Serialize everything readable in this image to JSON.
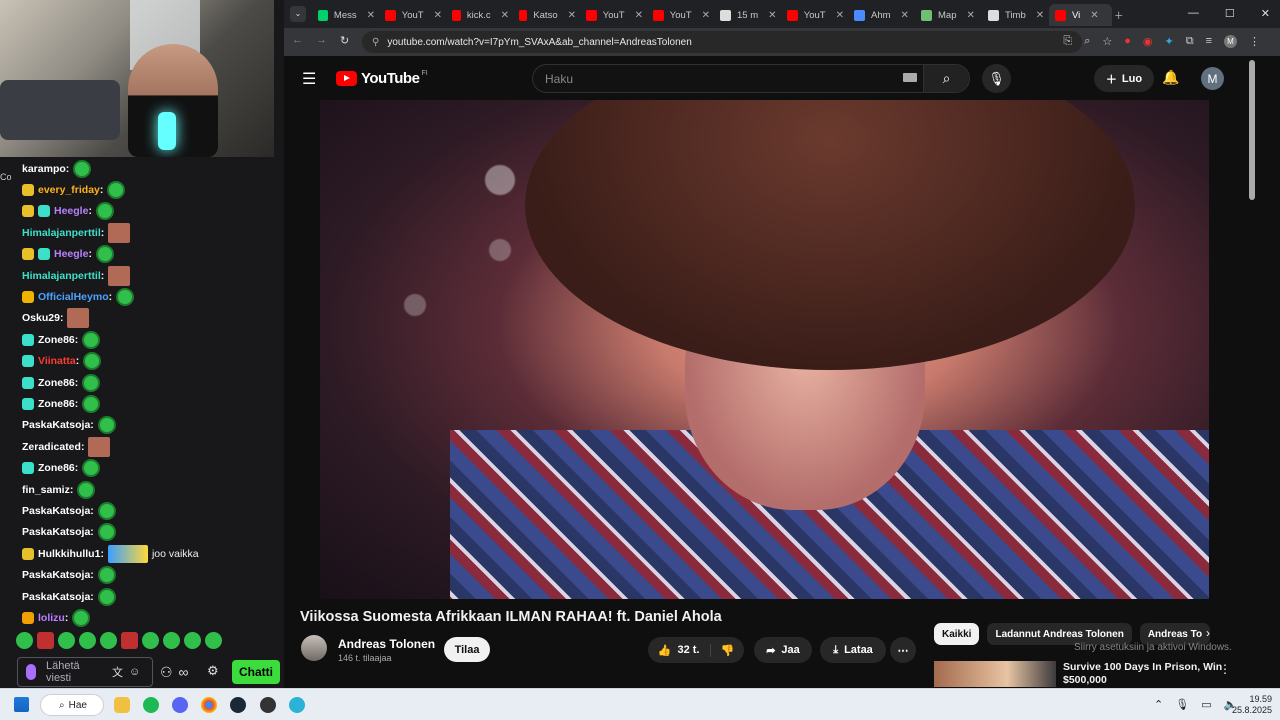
{
  "chat": {
    "messages": [
      {
        "user": "karampo",
        "color": "#ffffff",
        "badges": [],
        "emote": "green",
        "text": ""
      },
      {
        "user": "every_friday",
        "color": "#ffb31a",
        "badges": [
          "#e8c12a"
        ],
        "emote": "green",
        "text": ""
      },
      {
        "user": "Heegle",
        "color": "#b980ff",
        "badges": [
          "#e8c12a",
          "#3ce0c8"
        ],
        "emote": "green",
        "text": ""
      },
      {
        "user": "Himalajanperttil",
        "color": "#3ce0c8",
        "badges": [],
        "emote": "img",
        "text": ""
      },
      {
        "user": "Heegle",
        "color": "#b980ff",
        "badges": [
          "#e8c12a",
          "#3ce0c8"
        ],
        "emote": "green",
        "text": ""
      },
      {
        "user": "Himalajanperttil",
        "color": "#3ce0c8",
        "badges": [],
        "emote": "img",
        "text": ""
      },
      {
        "user": "OfficialHeymo",
        "color": "#4aa3ff",
        "badges": [
          "#f0b400"
        ],
        "emote": "green",
        "text": ""
      },
      {
        "user": "Osku29",
        "color": "#ffffff",
        "badges": [],
        "emote": "img",
        "text": ""
      },
      {
        "user": "Zone86",
        "color": "#ffffff",
        "badges": [
          "#3ce0c8"
        ],
        "emote": "green",
        "text": ""
      },
      {
        "user": "Viinatta",
        "color": "#ff3b30",
        "badges": [
          "#3ce0c8"
        ],
        "emote": "green",
        "text": ""
      },
      {
        "user": "Zone86",
        "color": "#ffffff",
        "badges": [
          "#3ce0c8"
        ],
        "emote": "green",
        "text": ""
      },
      {
        "user": "Zone86",
        "color": "#ffffff",
        "badges": [
          "#3ce0c8"
        ],
        "emote": "green",
        "text": ""
      },
      {
        "user": "PaskaKatsoja",
        "color": "#ffffff",
        "badges": [],
        "emote": "green",
        "text": ""
      },
      {
        "user": "Zeradicated",
        "color": "#ffffff",
        "badges": [],
        "emote": "img",
        "text": ""
      },
      {
        "user": "Zone86",
        "color": "#ffffff",
        "badges": [
          "#3ce0c8"
        ],
        "emote": "green",
        "text": ""
      },
      {
        "user": "fin_samiz",
        "color": "#ffffff",
        "badges": [],
        "emote": "green",
        "text": ""
      },
      {
        "user": "PaskaKatsoja",
        "color": "#ffffff",
        "badges": [],
        "emote": "green",
        "text": ""
      },
      {
        "user": "PaskaKatsoja",
        "color": "#ffffff",
        "badges": [],
        "emote": "green",
        "text": ""
      },
      {
        "user": "Hulkkihullu1",
        "color": "#ffffff",
        "badges": [
          "#e8c12a"
        ],
        "emote": "wide",
        "text": "joo vaikka"
      },
      {
        "user": "PaskaKatsoja",
        "color": "#ffffff",
        "badges": [],
        "emote": "green",
        "text": ""
      },
      {
        "user": "PaskaKatsoja",
        "color": "#ffffff",
        "badges": [],
        "emote": "green",
        "text": ""
      },
      {
        "user": "lolizu",
        "color": "#b980ff",
        "badges": [
          "#f0a000"
        ],
        "emote": "green",
        "text": ""
      }
    ],
    "side_label": "Co",
    "input_placeholder": "Lähetä viesti",
    "chat_button": "Chatti",
    "points_label": "∞"
  },
  "browser": {
    "tabs": [
      {
        "label": "Mess",
        "fav": "#00d16c"
      },
      {
        "label": "YouT",
        "fav": "#ff0000"
      },
      {
        "label": "kick.c",
        "fav": "#ff0000"
      },
      {
        "label": "Katso",
        "fav": "#ff0000"
      },
      {
        "label": "YouT",
        "fav": "#ff0000"
      },
      {
        "label": "YouT",
        "fav": "#ff0000"
      },
      {
        "label": "15 m",
        "fav": "#dddddd"
      },
      {
        "label": "YouT",
        "fav": "#ff0000"
      },
      {
        "label": "Ahm",
        "fav": "#4a8cff"
      },
      {
        "label": "Map",
        "fav": "#6fbf73"
      },
      {
        "label": "Timb",
        "fav": "#dddddd"
      },
      {
        "label": "Vi",
        "fav": "#ff0000"
      }
    ],
    "url": "youtube.com/watch?v=I7pYm_SVAxA&ab_channel=AndreasTolonen",
    "profile_initial": "M"
  },
  "youtube": {
    "logo_text": "YouTube",
    "region": "FI",
    "search_placeholder": "Haku",
    "create_label": "Luo",
    "avatar_initial": "M",
    "video_title": "Viikossa Suomesta Afrikkaan ILMAN RAHAA! ft. Daniel Ahola",
    "channel_name": "Andreas Tolonen",
    "subscribers": "146 t. tilaajaa",
    "subscribe_label": "Tilaa",
    "likes": "32 t.",
    "share_label": "Jaa",
    "download_label": "Lataa",
    "chips": [
      "Kaikki",
      "Ladannut Andreas Tolonen",
      "Andreas To"
    ],
    "watermark": "Siirry asetuksiin ja aktivoi Windows.",
    "rec_title": "Survive 100 Days In Prison, Win $500,000"
  },
  "taskbar": {
    "search_label": "Hae",
    "time": "19.59",
    "date": "25.8.2025"
  }
}
